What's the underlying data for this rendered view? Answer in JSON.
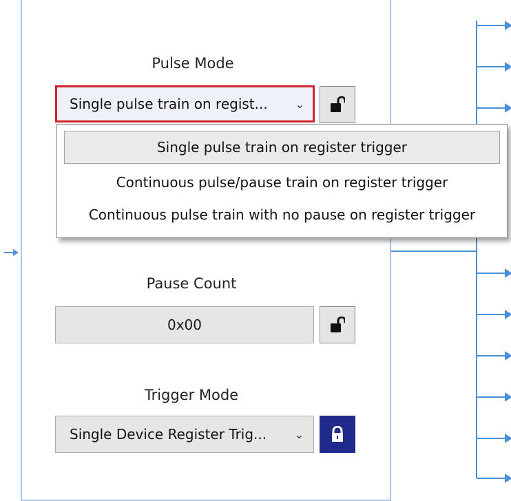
{
  "pulse_mode": {
    "label": "Pulse Mode",
    "selected": "Single pulse train on regist...",
    "options": [
      "Single pulse train on register trigger",
      "Continuous pulse/pause train on register trigger",
      "Continuous pulse train with no pause on register trigger"
    ],
    "lock_icon": "unlocked-padlock-icon"
  },
  "pause_count": {
    "label": "Pause Count",
    "value": "0x00",
    "lock_icon": "unlocked-padlock-icon"
  },
  "trigger_mode": {
    "label": "Trigger Mode",
    "selected": "Single Device Register Trig...",
    "lock_icon": "locked-padlock-icon"
  },
  "colors": {
    "focus_border": "#d2222f",
    "locked_button": "#1f2a8a",
    "connector_blue": "#4a90d9"
  }
}
